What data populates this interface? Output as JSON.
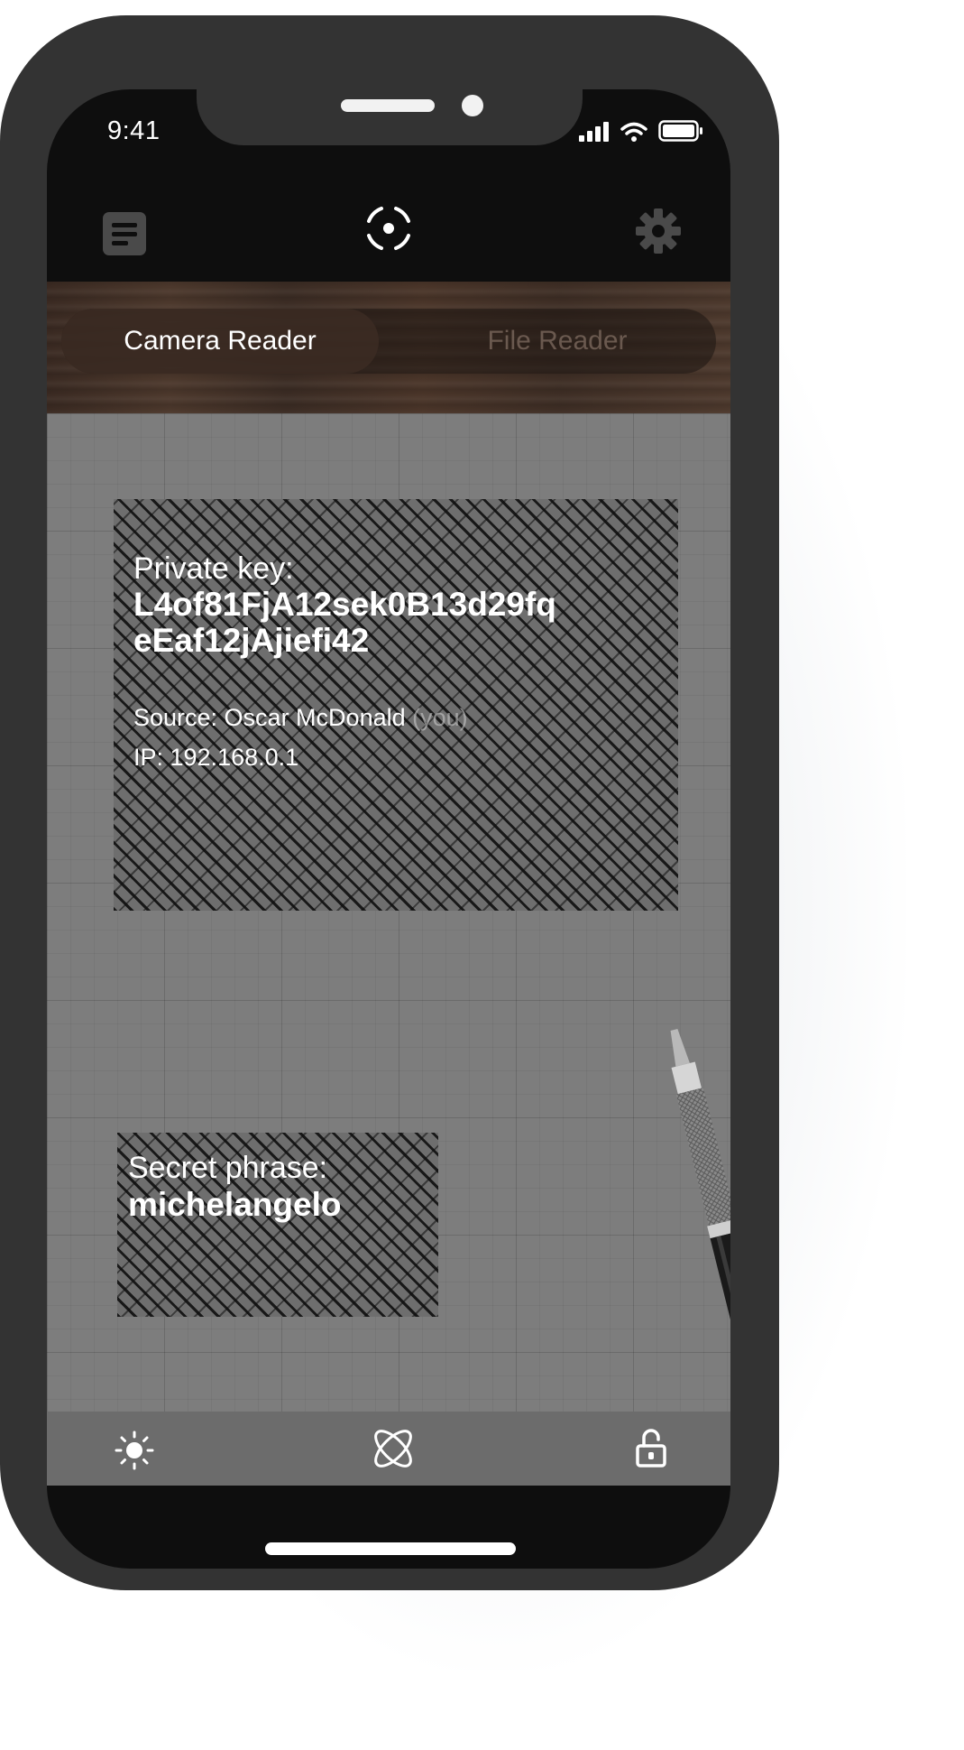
{
  "status_bar": {
    "time": "9:41",
    "icons": [
      "signal-icon",
      "wifi-icon",
      "battery-icon"
    ]
  },
  "nav": {
    "left_icon": "document-icon",
    "center_icon": "scan-target-icon",
    "right_icon": "gear-icon"
  },
  "segments": {
    "active": "Camera Reader",
    "inactive": "File Reader"
  },
  "scan": {
    "private_key_label": "Private key:",
    "private_key_line1": "L4of81FjA12sek0B13d29fq",
    "private_key_line2": "eEaf12jAjiefi42",
    "source_label": "Source: Oscar McDonald",
    "source_suffix": "(you)",
    "ip": "IP: 192.168.0.1",
    "secret_label": "Secret phrase:",
    "secret_value": "michelangelo"
  },
  "toolbar": {
    "left_icon": "brightness-icon",
    "center_icon": "atom-icon",
    "right_icon": "unlock-icon"
  },
  "colors": {
    "frame": "#333333",
    "screen_bg": "#0e0e0e",
    "toolbar_bg": "#6c6c6c",
    "camera_bg": "#7d7d7d"
  }
}
